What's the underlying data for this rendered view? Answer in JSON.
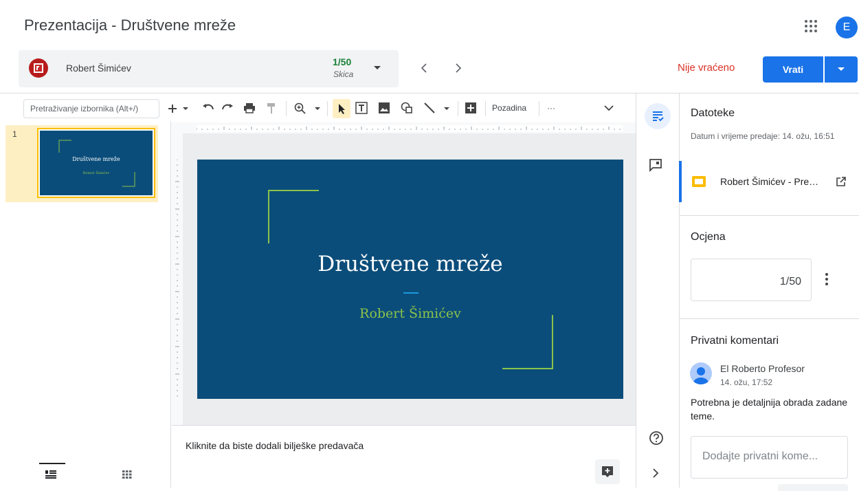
{
  "header": {
    "title": "Prezentacija - Društvene mreže",
    "avatar_letter": "E",
    "apps_icon": "apps-grid-icon"
  },
  "student_bar": {
    "student_name": "Robert Šimićev",
    "grade": "1/50",
    "status": "Skica",
    "not_returned": "Nije vraćeno",
    "return_label": "Vrati"
  },
  "toolbar": {
    "search_placeholder": "Pretraživanje izbornika (Alt+/)",
    "background_label": "Pozadina",
    "more_label": "···"
  },
  "filmstrip": {
    "slide_number": "1",
    "thumb_title": "Društvene mreže",
    "thumb_subtitle": "Robert Šimićev"
  },
  "slide": {
    "title": "Društvene mreže",
    "subtitle": "Robert Šimićev",
    "background_color": "#0b4d7a",
    "accent_color": "#8bc34a"
  },
  "notes": {
    "placeholder": "Kliknite da biste dodali bilješke predavača"
  },
  "panel": {
    "files_title": "Datoteke",
    "submit_time": "Datum i vrijeme predaje: 14. ožu, 16:51",
    "file_name": "Robert Šimićev - Prezentacija - Društvene mreže",
    "grade_title": "Ocjena",
    "grade_value": "1/50",
    "comments_title": "Privatni komentari",
    "commenter_name": "El Roberto Profesor",
    "comment_time": "14. ožu, 17:52",
    "comment_text": "Potrebna je detaljnija obrada zadane teme.",
    "comment_placeholder": "Dodajte privatni kome..."
  },
  "colors": {
    "brand_blue": "#1a73e8",
    "not_returned_red": "#d93025",
    "grade_green": "#188038"
  }
}
